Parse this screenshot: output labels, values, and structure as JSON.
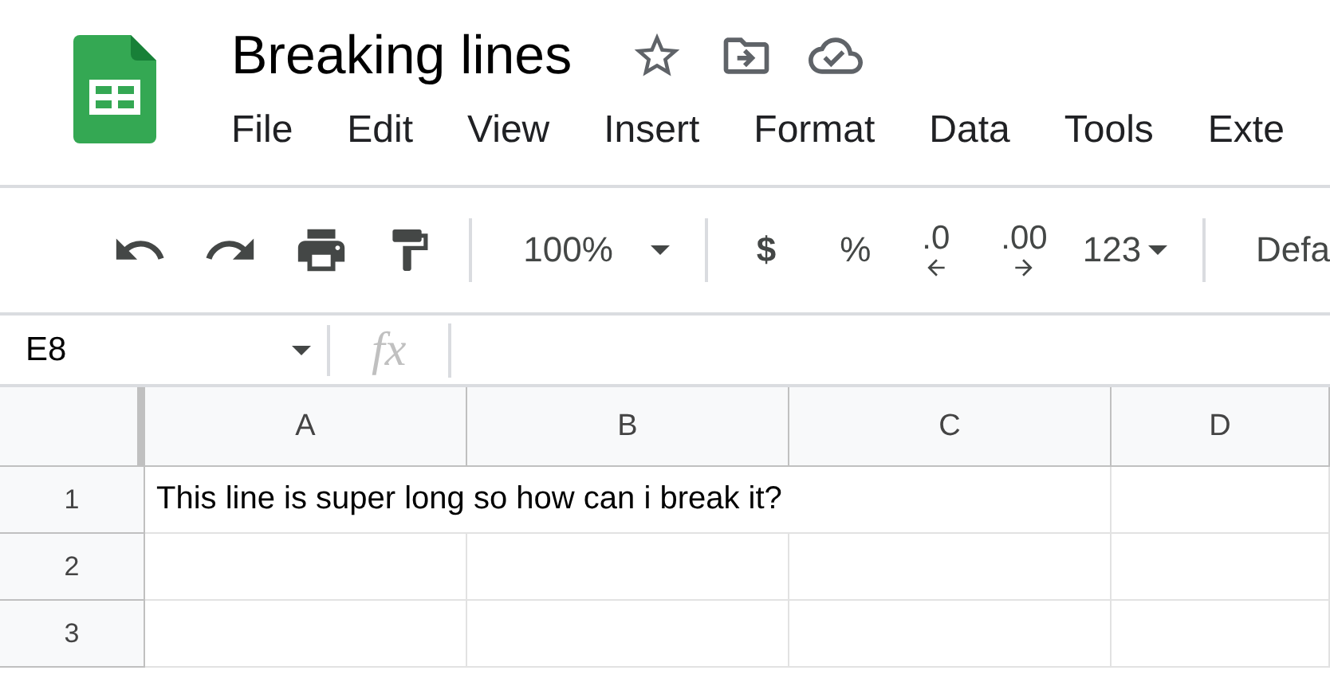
{
  "document": {
    "title": "Breaking lines"
  },
  "menu": [
    "File",
    "Edit",
    "View",
    "Insert",
    "Format",
    "Data",
    "Tools",
    "Exte"
  ],
  "toolbar": {
    "zoom": "100%",
    "currency": "$",
    "percent": "%",
    "decrease_decimals": ".0",
    "increase_decimals": ".00",
    "more_formats": "123",
    "font": "Defa"
  },
  "formula_bar": {
    "cell_ref": "E8",
    "fx": "fx"
  },
  "columns": [
    "A",
    "B",
    "C",
    "D"
  ],
  "rows": [
    {
      "number": "1",
      "cells": [
        "This line is super long so how can i break it?"
      ]
    },
    {
      "number": "2",
      "cells": []
    },
    {
      "number": "3",
      "cells": []
    }
  ]
}
